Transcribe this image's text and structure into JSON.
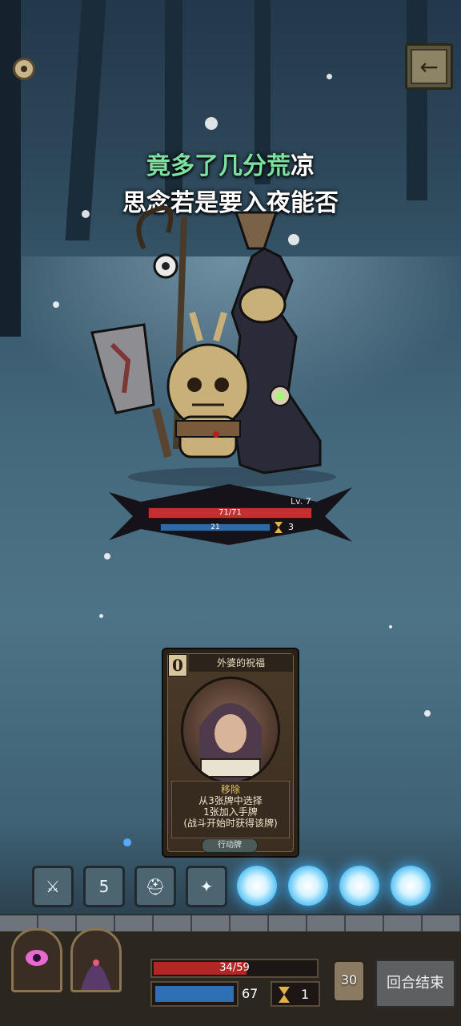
{
  "lyrics": {
    "line1_highlight": "竟多了几分荒",
    "line1_rest": "凉",
    "line2": "思念若是要入夜能否"
  },
  "enemy": {
    "hp": "71/71",
    "level": "Lv. 7",
    "shield": "21",
    "action_count": "3",
    "hp_fraction": 1.0
  },
  "card": {
    "cost": "0",
    "name": "外婆的祝福",
    "keyword": "移除",
    "description_line1": "从3张牌中选择",
    "description_line2": "1张加入手牌",
    "description_line3": "(战斗开始时获得该牌)",
    "type": "行动牌"
  },
  "skill_slots": [
    {
      "icon": "crossed-swords-icon",
      "label": ""
    },
    {
      "icon": "lightning-five-icon",
      "label": "5"
    },
    {
      "icon": "helmet-icon",
      "label": ""
    },
    {
      "icon": "bird-icon",
      "label": ""
    }
  ],
  "player": {
    "hp": "34/59",
    "hp_fraction": 0.576,
    "mana": "67",
    "actions": "1",
    "deck_count": "30"
  },
  "buttons": {
    "end_turn": "回合结束"
  },
  "colors": {
    "highlight_lyric": "#7ee0a0",
    "hp_red": "#c43030",
    "mana_blue": "#2f6fb3",
    "orb_glow": "#3fb3ff"
  }
}
